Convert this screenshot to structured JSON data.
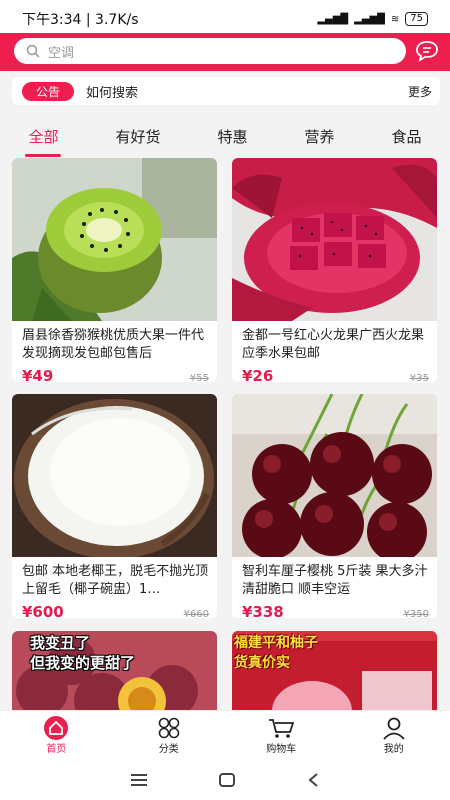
{
  "status": {
    "time": "下午3:34 | 3.7K/s",
    "battery": "75",
    "net1": "HD 4G",
    "net2": "HD 4G"
  },
  "search": {
    "placeholder": "空调"
  },
  "notice": {
    "badge": "公告",
    "text": "如何搜索",
    "more": "更多"
  },
  "tabs": [
    "全部",
    "有好货",
    "特惠",
    "营养",
    "食品"
  ],
  "products": [
    {
      "title": "眉县徐香猕猴桃优质大果一件代发现摘现发包邮包售后",
      "price": "¥49",
      "old_price": "¥55",
      "image": "kiwi"
    },
    {
      "title": "金都一号红心火龙果广西火龙果应季水果包邮",
      "price": "¥26",
      "old_price": "¥35",
      "image": "dragon-fruit"
    },
    {
      "title": "包邮 本地老椰王，脱毛不抛光顶上留毛（椰子碗盅）1…",
      "price": "¥600",
      "old_price": "¥660",
      "image": "coconut"
    },
    {
      "title": "智利车厘子樱桃 5斤装 果大多汁 清甜脆口 顺丰空运",
      "price": "¥338",
      "old_price": "¥350",
      "image": "cherries"
    },
    {
      "title": "",
      "price": "",
      "old_price": "",
      "image": "passion-fruit",
      "overlay": "我变丑了\n但我变的更甜了"
    },
    {
      "title": "",
      "price": "",
      "old_price": "",
      "image": "pomelo",
      "overlay": "福建平和柚子\n货真价实"
    }
  ],
  "tabbar": [
    {
      "label": "首页",
      "icon": "home-icon"
    },
    {
      "label": "分类",
      "icon": "category-icon"
    },
    {
      "label": "购物车",
      "icon": "cart-icon"
    },
    {
      "label": "我的",
      "icon": "user-icon"
    }
  ],
  "colors": {
    "accent": "#ec1f4f",
    "price": "#e8194b"
  }
}
